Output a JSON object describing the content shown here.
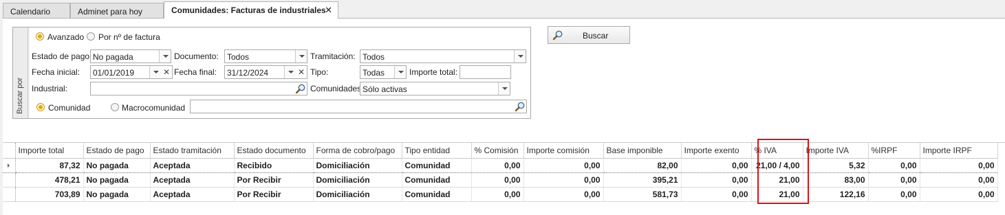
{
  "tabs": [
    {
      "label": "Calendario"
    },
    {
      "label": "Adminet para hoy"
    },
    {
      "label": "Comunidades: Facturas de industriales"
    }
  ],
  "search": {
    "group_label": "Buscar por",
    "mode_advanced": "Avanzado",
    "mode_invoice": "Por nº de factura",
    "estado_pago_label": "Estado de pago:",
    "estado_pago_value": "No pagada",
    "documento_label": "Documento:",
    "documento_value": "Todos",
    "tramitacion_label": "Tramitación:",
    "tramitacion_value": "Todos",
    "fecha_inicial_label": "Fecha inicial:",
    "fecha_inicial_value": "01/01/2019",
    "fecha_final_label": "Fecha final:",
    "fecha_final_value": "31/12/2024",
    "tipo_label": "Tipo:",
    "tipo_value": "Todas",
    "importe_total_label": "Importe total:",
    "importe_total_value": "",
    "industrial_label": "Industrial:",
    "industrial_value": "",
    "comunidades_label": "Comunidades:",
    "comunidades_value": "Sólo activas",
    "scope_comunidad": "Comunidad",
    "scope_macro": "Macrocomunidad",
    "scope_value": "",
    "button_label": "Buscar"
  },
  "grid": {
    "columns": [
      "Importe total",
      "Estado de pago",
      "Estado tramitación",
      "Estado documento",
      "Forma de cobro/pago",
      "Tipo entidad",
      "% Comisión",
      "Importe comisión",
      "Base imponible",
      "Importe exento",
      "% IVA",
      "Importe IVA",
      "%IRPF",
      "Importe IRPF"
    ],
    "rows": [
      [
        "87,32",
        "No pagada",
        "Aceptada",
        "Recibido",
        "Domiciliación",
        "Comunidad",
        "0,00",
        "0,00",
        "82,00",
        "0,00",
        "21,00 / 4,00",
        "5,32",
        "0,00",
        "0,00"
      ],
      [
        "478,21",
        "No pagada",
        "Aceptada",
        "Por Recibir",
        "Domiciliación",
        "Comunidad",
        "0,00",
        "0,00",
        "395,21",
        "0,00",
        "21,00",
        "83,00",
        "0,00",
        "0,00"
      ],
      [
        "703,89",
        "No pagada",
        "Aceptada",
        "Por Recibir",
        "Domiciliación",
        "Comunidad",
        "0,00",
        "0,00",
        "581,73",
        "0,00",
        "21,00",
        "122,16",
        "0,00",
        "0,00"
      ]
    ]
  },
  "colors": {
    "accent_radio": "#e0a800",
    "highlight_box": "#d8141c"
  }
}
